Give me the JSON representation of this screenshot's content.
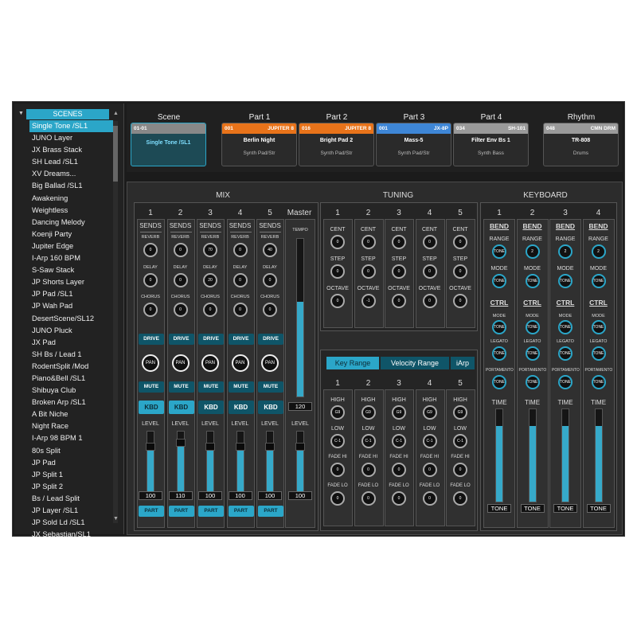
{
  "sidebar": {
    "header": "SCENES",
    "selected_index": 0,
    "items": [
      "Single Tone /SL1",
      "JUNO Layer",
      "JX Brass Stack",
      "SH Lead /SL1",
      "XV Dreams...",
      "Big Ballad /SL1",
      "Awakening",
      "Weightless",
      "Dancing Melody",
      "Koenji Party",
      "Jupiter Edge",
      "I-Arp 160 BPM",
      "S-Saw Stack",
      "JP Shorts Layer",
      "JP Pad /SL1",
      "JP Wah Pad",
      "DesertScene/SL12",
      "JUNO Pluck",
      "JX Pad",
      "SH Bs / Lead 1",
      "RodentSplit /Mod",
      "Piano&Bell /SL1",
      "Shibuya Club",
      "Broken Arp /SL1",
      "A Bit Niche",
      "Night Race",
      "I-Arp 98 BPM 1",
      "80s Split",
      "JP Pad",
      "JP Split 1",
      "JP Split 2",
      "Bs / Lead Split",
      "JP Layer /SL1",
      "JP Sold Ld /SL1",
      "JX Sebastian/SL1"
    ]
  },
  "parts": [
    {
      "title": "Scene",
      "num": "01-01",
      "model": "",
      "name": "Single Tone /SL1",
      "cat": "",
      "color": "#888888"
    },
    {
      "title": "Part 1",
      "num": "001",
      "model": "JUPITER 8",
      "name": "Berlin Night",
      "cat": "Synth Pad/Str",
      "color": "#e8731a"
    },
    {
      "title": "Part 2",
      "num": "016",
      "model": "JUPITER 8",
      "name": "Bright Pad 2",
      "cat": "Synth Pad/Str",
      "color": "#e8731a"
    },
    {
      "title": "Part 3",
      "num": "001",
      "model": "JX-8P",
      "name": "Mass-5",
      "cat": "Synth Pad/Str",
      "color": "#3e86d6"
    },
    {
      "title": "Part 4",
      "num": "034",
      "model": "SH-101",
      "name": "Filter Env Bs 1",
      "cat": "Synth Bass",
      "color": "#9a9a9a"
    },
    {
      "title": "Rhythm",
      "num": "048",
      "model": "CMN DRM",
      "name": "TR-808",
      "cat": "Drums",
      "color": "#9a9a9a"
    }
  ],
  "mix": {
    "title": "MIX",
    "master": "Master",
    "channels": [
      {
        "num": "1",
        "reverb": "0",
        "delay": "0",
        "chorus": "0",
        "level": "100",
        "level_pct": 0.75
      },
      {
        "num": "2",
        "reverb": "0",
        "delay": "0",
        "chorus": "0",
        "level": "110",
        "level_pct": 0.8
      },
      {
        "num": "3",
        "reverb": "70",
        "delay": "20",
        "chorus": "0",
        "level": "100",
        "level_pct": 0.75
      },
      {
        "num": "4",
        "reverb": "0",
        "delay": "0",
        "chorus": "0",
        "level": "100",
        "level_pct": 0.75
      },
      {
        "num": "5",
        "reverb": "40",
        "delay": "0",
        "chorus": "0",
        "level": "100",
        "level_pct": 0.75
      }
    ],
    "labels": {
      "sends": "SENDS",
      "reverb": "REVERB",
      "delay": "DELAY",
      "chorus": "CHORUS",
      "drive": "DRIVE",
      "pan": "PAN",
      "mute": "MUTE",
      "kbd": "KBD",
      "level": "LEVEL",
      "part": "PART"
    },
    "tempo_label": "TEMPO",
    "tempo": "120",
    "tempo_pct": 0.6,
    "master_level_label": "LEVEL",
    "master_level": "100",
    "master_level_pct": 0.75
  },
  "tuning": {
    "title": "TUNING",
    "channels": [
      {
        "num": "1",
        "cent": "0",
        "step": "0",
        "octave": "0"
      },
      {
        "num": "2",
        "cent": "0",
        "step": "0",
        "octave": "-1"
      },
      {
        "num": "3",
        "cent": "0",
        "step": "0",
        "octave": "0"
      },
      {
        "num": "4",
        "cent": "0",
        "step": "0",
        "octave": "0"
      },
      {
        "num": "5",
        "cent": "0",
        "step": "0",
        "octave": "0"
      }
    ],
    "labels": {
      "cent": "CENT",
      "step": "STEP",
      "octave": "OCTAVE"
    }
  },
  "range": {
    "tabs": [
      "Key Range",
      "Velocity Range",
      "iArp"
    ],
    "active_tab": 0,
    "channels": [
      {
        "num": "1",
        "high": "G9",
        "low": "C-1",
        "fade_hi": "0",
        "fade_lo": "0"
      },
      {
        "num": "2",
        "high": "G9",
        "low": "C-1",
        "fade_hi": "0",
        "fade_lo": "0"
      },
      {
        "num": "3",
        "high": "G9",
        "low": "C-1",
        "fade_hi": "0",
        "fade_lo": "0"
      },
      {
        "num": "4",
        "high": "G9",
        "low": "C-1",
        "fade_hi": "0",
        "fade_lo": "0"
      },
      {
        "num": "5",
        "high": "G9",
        "low": "C-1",
        "fade_hi": "0",
        "fade_lo": "0"
      }
    ],
    "labels": {
      "high": "HIGH",
      "low": "LOW",
      "fade_hi": "FADE HI",
      "fade_lo": "FADE LO"
    }
  },
  "keyboard": {
    "title": "KEYBOARD",
    "channels": [
      {
        "num": "1",
        "range": "TONE",
        "mode": "TONE",
        "ctrl_mode": "TONE",
        "legato": "TONE",
        "portamento": "TONE",
        "time_pct": 0.82
      },
      {
        "num": "2",
        "range": "2",
        "mode": "TONE",
        "ctrl_mode": "TONE",
        "legato": "TONE",
        "portamento": "TONE",
        "time_pct": 0.82
      },
      {
        "num": "3",
        "range": "2",
        "mode": "TONE",
        "ctrl_mode": "TONE",
        "legato": "TONE",
        "portamento": "TONE",
        "time_pct": 0.82
      },
      {
        "num": "4",
        "range": "2",
        "mode": "TONE",
        "ctrl_mode": "TONE",
        "legato": "TONE",
        "portamento": "TONE",
        "time_pct": 0.82
      }
    ],
    "labels": {
      "bend": "BEND",
      "range": "RANGE",
      "mode": "MODE",
      "ctrl": "CTRL",
      "legato": "LEGATO",
      "portamento": "PORTAMENTO",
      "time": "TIME",
      "tone": "TONE"
    }
  }
}
